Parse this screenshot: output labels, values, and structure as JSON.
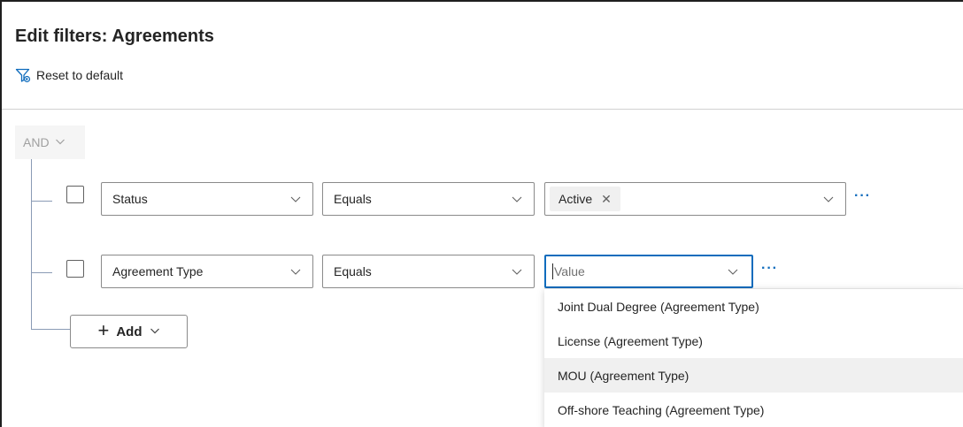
{
  "header": {
    "title": "Edit filters: Agreements",
    "reset_label": "Reset to default"
  },
  "group": {
    "operator": "AND"
  },
  "rows": [
    {
      "field": "Status",
      "operator": "Equals",
      "value_tag": "Active",
      "more": "···"
    },
    {
      "field": "Agreement Type",
      "operator": "Equals",
      "value_placeholder": "Value",
      "more": "···"
    }
  ],
  "add": {
    "label": "Add"
  },
  "dropdown": {
    "options": [
      "Joint Dual Degree (Agreement Type)",
      "License (Agreement Type)",
      "MOU (Agreement Type)",
      "Off-shore Teaching (Agreement Type)"
    ],
    "hovered_index": 2
  },
  "colors": {
    "accent": "#0f6cbd",
    "tree_line": "#8a9bb5"
  }
}
